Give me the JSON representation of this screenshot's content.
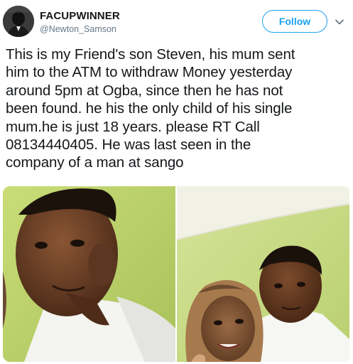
{
  "user": {
    "display_name": "FACUPWINNER",
    "handle": "@Newton_Samson",
    "avatar_icon": "profile-avatar"
  },
  "follow_button": {
    "label": "Follow"
  },
  "menu": {
    "icon": "chevron-down-icon"
  },
  "tweet": {
    "text": "This is my Friend's son Steven, his mum sent\nhim to the ATM to withdraw Money yesterday\naround 5pm at Ogba, since then he has not\nbeen found. he his the only child of his single\nmum.he is just 18 years. please RT Call\n08134440405. He was last seen in the\ncompany of a man at sango"
  },
  "media": {
    "photos": [
      "photo-boy-selfie",
      "photo-boy-with-woman"
    ]
  },
  "colors": {
    "accent": "#1da1f2",
    "text": "#14171a",
    "secondary_text": "#657786"
  }
}
